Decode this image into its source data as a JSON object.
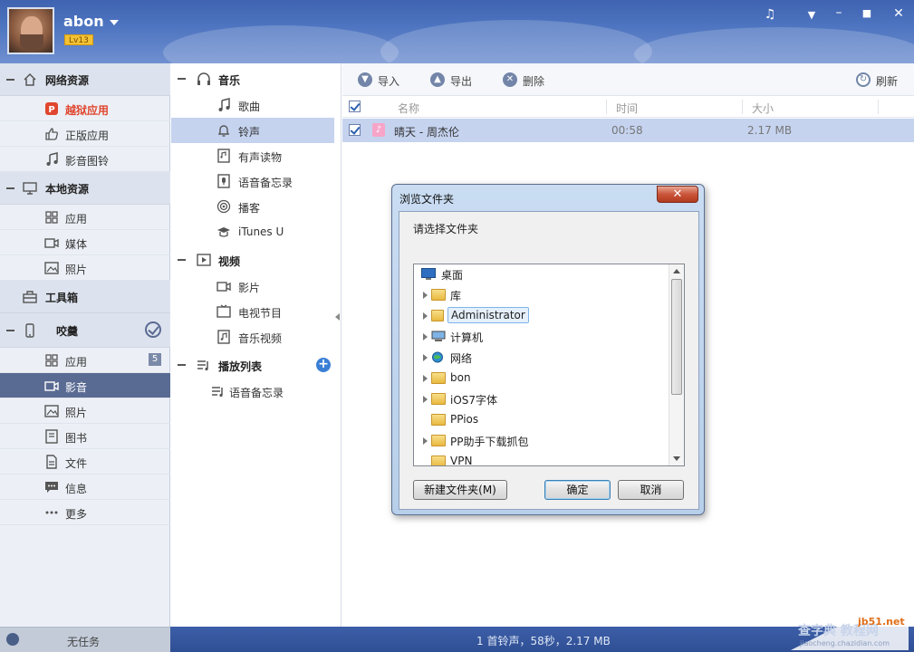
{
  "header": {
    "username": "abon",
    "level": "Lv13",
    "controls": [
      "music-icon",
      "menu-icon",
      "minimize-icon",
      "maximize-icon",
      "close-icon"
    ]
  },
  "left_nav": {
    "sections": [
      {
        "label": "网络资源",
        "items": [
          {
            "label": "越狱应用",
            "active": true
          },
          {
            "label": "正版应用"
          },
          {
            "label": "影音图铃"
          }
        ]
      },
      {
        "label": "本地资源",
        "items": [
          {
            "label": "应用"
          },
          {
            "label": "媒体"
          },
          {
            "label": "照片"
          }
        ]
      },
      {
        "label": "工具箱",
        "items": []
      },
      {
        "label": "咬羹",
        "items": [
          {
            "label": "应用",
            "badge": "5"
          },
          {
            "label": "影音",
            "selected": true
          },
          {
            "label": "照片"
          },
          {
            "label": "图书"
          },
          {
            "label": "文件"
          },
          {
            "label": "信息"
          },
          {
            "label": "更多"
          }
        ]
      }
    ]
  },
  "media_nav": {
    "music": {
      "label": "音乐",
      "items": [
        "歌曲",
        "铃声",
        "有声读物",
        "语音备忘录",
        "播客",
        "iTunes U"
      ]
    },
    "video": {
      "label": "视频",
      "items": [
        "影片",
        "电视节目",
        "音乐视频"
      ]
    },
    "playlist": {
      "label": "播放列表",
      "items": [
        "语音备忘录"
      ]
    },
    "selected": "铃声"
  },
  "toolbar": {
    "import": "导入",
    "export": "导出",
    "delete": "删除",
    "refresh": "刷新"
  },
  "table": {
    "columns": [
      "名称",
      "时间",
      "大小"
    ],
    "rows": [
      {
        "name": "晴天 - 周杰伦",
        "time": "00:58",
        "size": "2.17 MB",
        "checked": true
      }
    ]
  },
  "dialog": {
    "title": "浏览文件夹",
    "close": "✕",
    "prompt": "请选择文件夹",
    "tree": [
      "桌面",
      "库",
      "Administrator",
      "计算机",
      "网络",
      "bon",
      "iOS7字体",
      "PPios",
      "PP助手下载抓包",
      "VPN"
    ],
    "selected": "Administrator",
    "new_folder": "新建文件夹(M)",
    "ok": "确定",
    "cancel": "取消"
  },
  "status": {
    "task": "无任务",
    "summary": "1 首铃声，58秒，2.17 MB"
  },
  "watermark": {
    "site": "jb51.net",
    "brand": "查字典 教程网",
    "url": "jiaocheng.chazidian.com"
  }
}
